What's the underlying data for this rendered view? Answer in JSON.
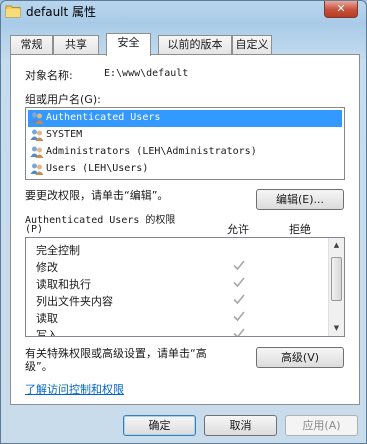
{
  "window": {
    "title": "default 属性",
    "close_symbol": "✕"
  },
  "tabs": [
    {
      "label": "常规",
      "active": false
    },
    {
      "label": "共享",
      "active": false
    },
    {
      "label": "安全",
      "active": true
    },
    {
      "label": "以前的版本",
      "active": false
    },
    {
      "label": "自定义",
      "active": false
    }
  ],
  "object": {
    "label": "对象名称:",
    "value": "E:\\www\\default"
  },
  "groups": {
    "label": "组或用户名(G):",
    "items": [
      {
        "name": "Authenticated Users",
        "selected": true
      },
      {
        "name": "SYSTEM",
        "selected": false
      },
      {
        "name": "Administrators (LEH\\Administrators)",
        "selected": false
      },
      {
        "name": "Users (LEH\\Users)",
        "selected": false
      }
    ]
  },
  "edit": {
    "hint": "要更改权限，请单击“编辑”。",
    "button": "编辑(E)..."
  },
  "permissions": {
    "title": "Authenticated Users 的权限",
    "title_suffix": "(P)",
    "allow_header": "允许",
    "deny_header": "拒绝",
    "rows": [
      {
        "name": "完全控制",
        "allow": false,
        "deny": false
      },
      {
        "name": "修改",
        "allow": true,
        "deny": false
      },
      {
        "name": "读取和执行",
        "allow": true,
        "deny": false
      },
      {
        "name": "列出文件夹内容",
        "allow": true,
        "deny": false
      },
      {
        "name": "读取",
        "allow": true,
        "deny": false
      },
      {
        "name": "写入",
        "allow": true,
        "deny": false
      }
    ]
  },
  "advanced": {
    "hint_line1": "有关特殊权限或高级设置，请单击“高",
    "hint_line2": "级”。",
    "button": "高级(V)"
  },
  "learn_link": "了解访问控制和权限",
  "footer": {
    "ok": "确定",
    "cancel": "取消",
    "apply": "应用(A)"
  },
  "colors": {
    "selection": "#3399ff",
    "link": "#0066cc",
    "check": "#a8a8a8"
  }
}
